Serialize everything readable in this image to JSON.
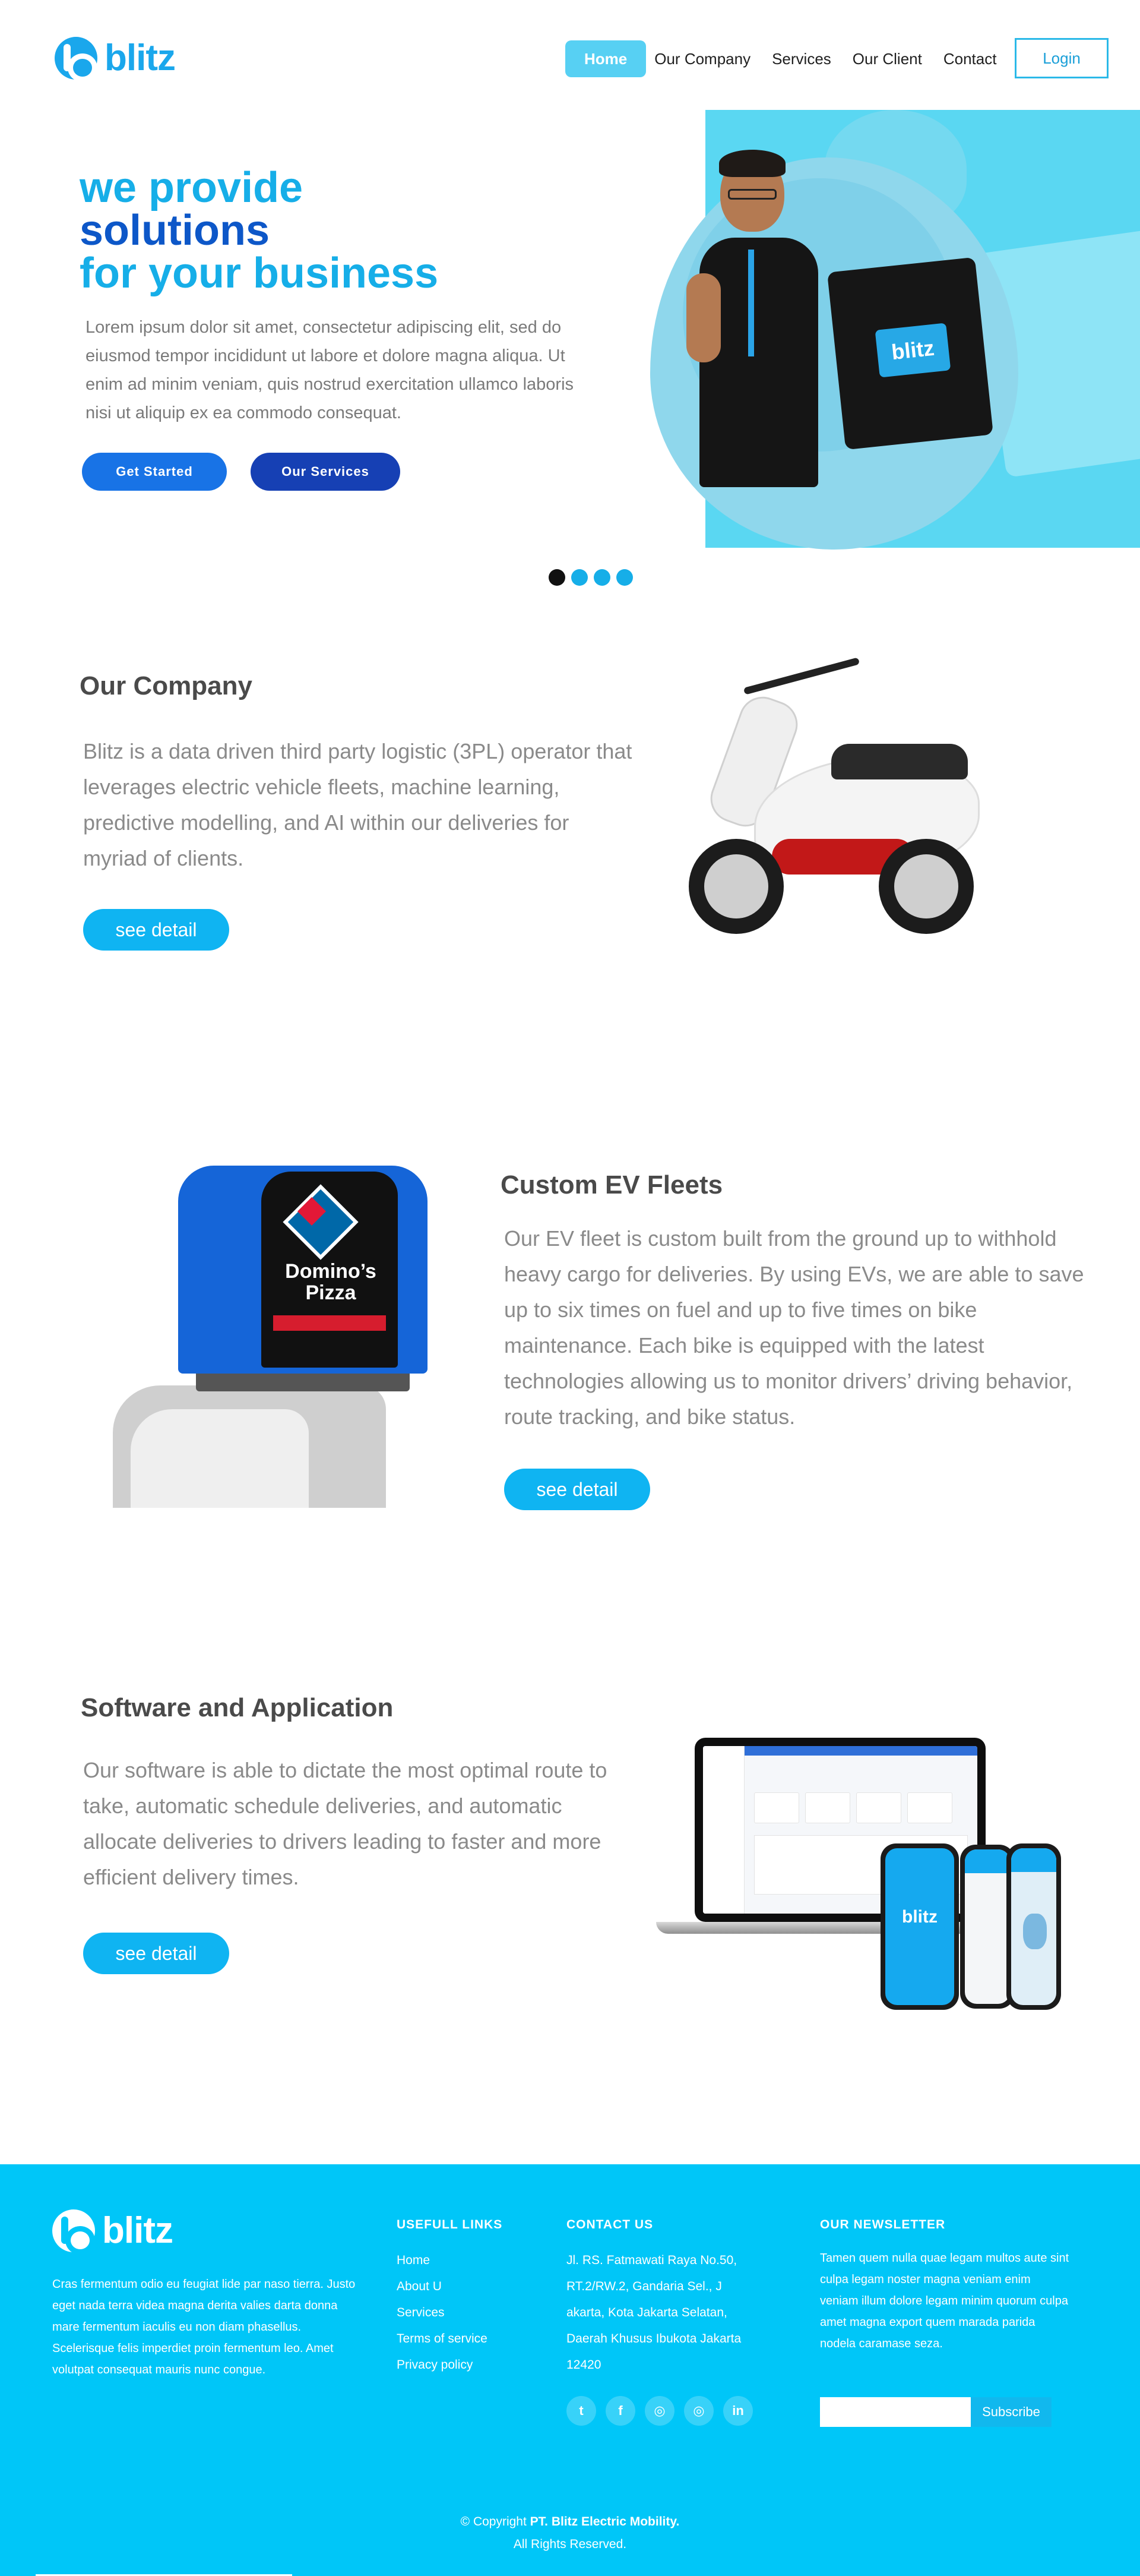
{
  "header": {
    "logo_text": "blitz",
    "nav": [
      {
        "label": "Home",
        "active": true
      },
      {
        "label": "Our Company",
        "active": false
      },
      {
        "label": "Services",
        "active": false
      },
      {
        "label": "Our Client",
        "active": false
      },
      {
        "label": "Contact",
        "active": false
      }
    ],
    "login_label": "Login"
  },
  "hero": {
    "title_line1": "we provide",
    "title_line2": "solutions",
    "title_line3": "for your business",
    "description": "Lorem ipsum dolor sit amet, consectetur adipiscing elit, sed do eiusmod tempor incididunt ut labore et dolore magna aliqua. Ut enim ad minim veniam, quis nostrud exercitation ullamco laboris nisi ut aliquip ex ea commodo consequat.",
    "btn_primary": "Get Started",
    "btn_secondary": "Our Services",
    "bag_logo": "blitz",
    "carousel_dots": 4,
    "carousel_active_index": 0
  },
  "company": {
    "title": "Our Company",
    "text": "Blitz is a data driven third party logistic (3PL) operator that leverages electric vehicle fleets, machine learning, predictive modelling, and AI within our deliveries for myriad of clients.",
    "button": "see detail"
  },
  "fleets": {
    "title": "Custom EV Fleets",
    "text": "Our EV fleet is custom built from the ground up to withhold heavy cargo for deliveries. By using EVs, we are able to save up to six times on fuel and up to five times on bike maintenance. Each bike is equipped with the latest technologies allowing us to monitor drivers’ driving behavior, route tracking, and bike status.",
    "button": "see detail",
    "box_brand_line1": "Domino’s",
    "box_brand_line2": "Pizza"
  },
  "software": {
    "title": "Software and Application",
    "text": "Our software is able to dictate the most optimal route to take, automatic schedule deliveries, and automatic allocate deliveries to drivers leading to faster and more efficient delivery times.",
    "button": "see detail",
    "phone_logo": "blitz"
  },
  "footer": {
    "logo_text": "blitz",
    "about": "Cras fermentum odio eu feugiat lide par naso tierra. Justo eget nada terra videa magna derita valies darta donna mare fermentum iaculis eu non diam phasellus. Scelerisque felis imperdiet proin fermentum leo. Amet volutpat consequat mauris nunc congue.",
    "links_title": "USEFULL LINKS",
    "links": [
      "Home",
      "About U",
      "Services",
      "Terms of service",
      "Privacy policy"
    ],
    "contact_title": "CONTACT US",
    "contact_address": "Jl. RS. Fatmawati Raya No.50, RT.2/RW.2, Gandaria Sel., J akarta, Kota Jakarta Selatan, Daerah Khusus Ibukota Jakarta 12420",
    "social": [
      "twitter-icon",
      "facebook-icon",
      "instagram-icon",
      "instagram-icon",
      "linkedin-icon"
    ],
    "newsletter_title": "OUR NEWSLETTER",
    "newsletter_text": "Tamen quem nulla quae legam multos aute sint culpa legam noster magna veniam enim veniam illum dolore legam minim quorum culpa amet magna export quem marada parida nodela caramase seza.",
    "newsletter_input_value": "",
    "subscribe_label": "Subscribe",
    "copyright_prefix": "© Copyright ",
    "copyright_company": "PT. Blitz Electric Mobility",
    "copyright_suffix": ".",
    "rights": "All Rights Reserved."
  },
  "colors": {
    "brand": "#1aa7ec",
    "hero_title_dark": "#0d57c8",
    "button_blue": "#1873e6",
    "button_navy": "#1640b4",
    "see_detail": "#0fb4f2",
    "footer_bg": "#00c6f8"
  }
}
